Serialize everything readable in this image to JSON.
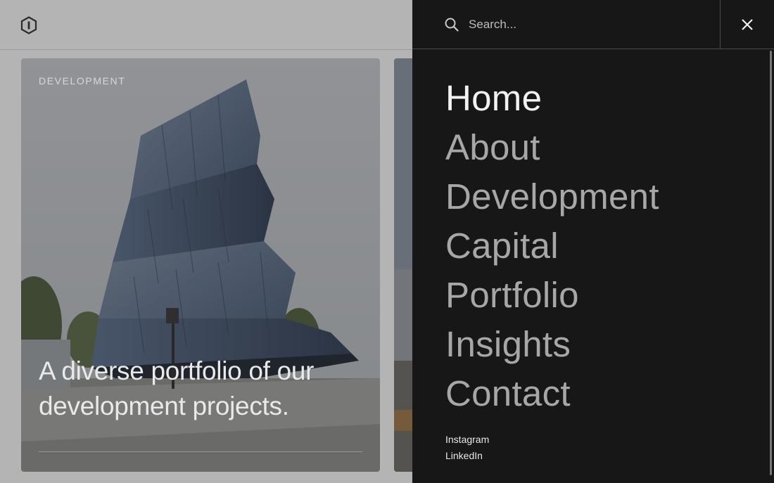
{
  "header": {
    "logo_icon": "hexagon-logo-icon"
  },
  "cards": [
    {
      "category": "DEVELOPMENT",
      "headline": "A diverse portfolio of our development projects."
    }
  ],
  "menu": {
    "search_placeholder": "Search...",
    "close_icon": "close-icon",
    "search_icon": "search-icon",
    "items": [
      {
        "label": "Home",
        "active": true
      },
      {
        "label": "About",
        "active": false
      },
      {
        "label": "Development",
        "active": false
      },
      {
        "label": "Capital",
        "active": false
      },
      {
        "label": "Portfolio",
        "active": false
      },
      {
        "label": "Insights",
        "active": false
      },
      {
        "label": "Contact",
        "active": false
      }
    ],
    "social": [
      {
        "label": "Instagram"
      },
      {
        "label": "LinkedIn"
      }
    ]
  },
  "colors": {
    "menu_background": "#171717",
    "menu_item_active": "#f2f2f2",
    "menu_item": "#a7a7a7",
    "page_dim": "#b4b4b4"
  }
}
